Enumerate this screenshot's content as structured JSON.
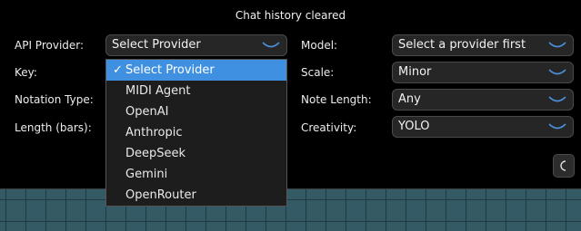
{
  "status": "Chat history cleared",
  "labels": {
    "api_provider": "API Provider:",
    "key": "Key:",
    "notation_type": "Notation Type:",
    "length": "Length (bars):",
    "model": "Model:",
    "scale": "Scale:",
    "note_length": "Note Length:",
    "creativity": "Creativity:"
  },
  "selects": {
    "api_provider": "Select Provider",
    "model": "Select a provider first",
    "scale": "Minor",
    "note_length": "Any",
    "creativity": "YOLO"
  },
  "dropdown": {
    "check_mark": "✓",
    "options": [
      "Select Provider",
      "MIDI Agent",
      "OpenAI",
      "Anthropic",
      "DeepSeek",
      "Gemini",
      "OpenRouter"
    ]
  },
  "icons": {
    "chevron": "chevron-down-icon",
    "theme": "moon-icon"
  },
  "colors": {
    "background": "#000000",
    "select_bg": "#262626",
    "chevron": "#4a90d9",
    "highlight": "#3f90e0",
    "grid": "#345a66"
  }
}
